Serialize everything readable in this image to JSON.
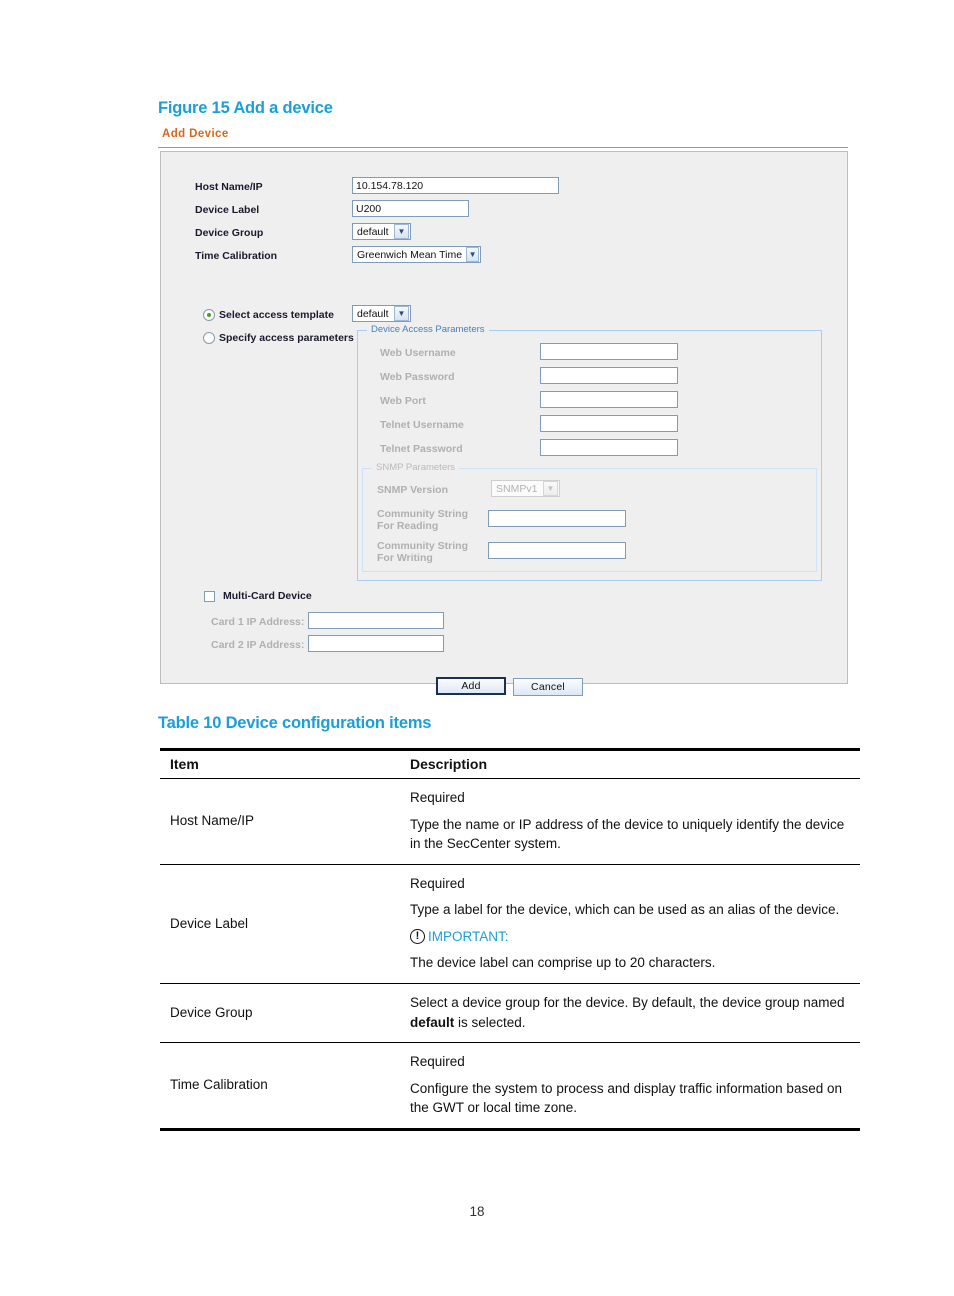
{
  "figure": {
    "caption": "Figure 15 Add a device",
    "panel_title": "Add Device",
    "fields": {
      "host_name_ip_label": "Host Name/IP",
      "host_name_ip_value": "10.154.78.120",
      "device_label_label": "Device Label",
      "device_label_value": "U200",
      "device_group_label": "Device Group",
      "device_group_value": "default",
      "time_calibration_label": "Time Calibration",
      "time_calibration_value": "Greenwich Mean Time"
    },
    "access_mode": {
      "select_template_label": "Select access template",
      "select_template_value": "default",
      "specify_params_label": "Specify access parameters",
      "selected": "select_template"
    },
    "device_access_parameters": {
      "legend": "Device Access Parameters",
      "rows": [
        {
          "label": "Web Username",
          "value": ""
        },
        {
          "label": "Web Password",
          "value": ""
        },
        {
          "label": "Web Port",
          "value": ""
        },
        {
          "label": "Telnet Username",
          "value": ""
        },
        {
          "label": "Telnet Password",
          "value": ""
        }
      ]
    },
    "snmp_parameters": {
      "legend": "SNMP Parameters",
      "version_label": "SNMP Version",
      "version_value": "SNMPv1",
      "community_read_label_line1": "Community String",
      "community_read_label_line2": "For Reading",
      "community_read_value": "",
      "community_write_label_line1": "Community String",
      "community_write_label_line2": "For Writing",
      "community_write_value": ""
    },
    "multi_card": {
      "checkbox_label": "Multi-Card Device",
      "checked": false,
      "card1_label": "Card 1 IP Address:",
      "card1_value": "",
      "card2_label": "Card 2 IP Address:",
      "card2_value": ""
    },
    "buttons": {
      "add": "Add",
      "cancel": "Cancel"
    }
  },
  "table": {
    "caption": "Table 10 Device configuration items",
    "headers": {
      "item": "Item",
      "description": "Description"
    },
    "rows": [
      {
        "item": "Host Name/IP",
        "required": "Required",
        "desc": "Type the name or IP address of the device to uniquely identify the device in the SecCenter system."
      },
      {
        "item": "Device Label",
        "required": "Required",
        "desc": "Type a label for the device, which can be used as an alias of the device.",
        "important_label": "IMPORTANT:",
        "important_text": "The device label can comprise up to 20 characters."
      },
      {
        "item": "Device Group",
        "desc_pre": "Select a device group for the device. By default, the device group named ",
        "desc_bold": "default",
        "desc_post": " is selected."
      },
      {
        "item": "Time Calibration",
        "required": "Required",
        "desc": "Configure the system to process and display traffic information based on the GWT or local time zone."
      }
    ]
  },
  "page_number": "18",
  "colors": {
    "accent_blue": "#1a9fd9",
    "panel_title_orange": "#d2691e",
    "rule_green": "#7cb342",
    "radio_dot_green": "#4a9e29",
    "fieldset_blue": "#a8cdf0"
  }
}
